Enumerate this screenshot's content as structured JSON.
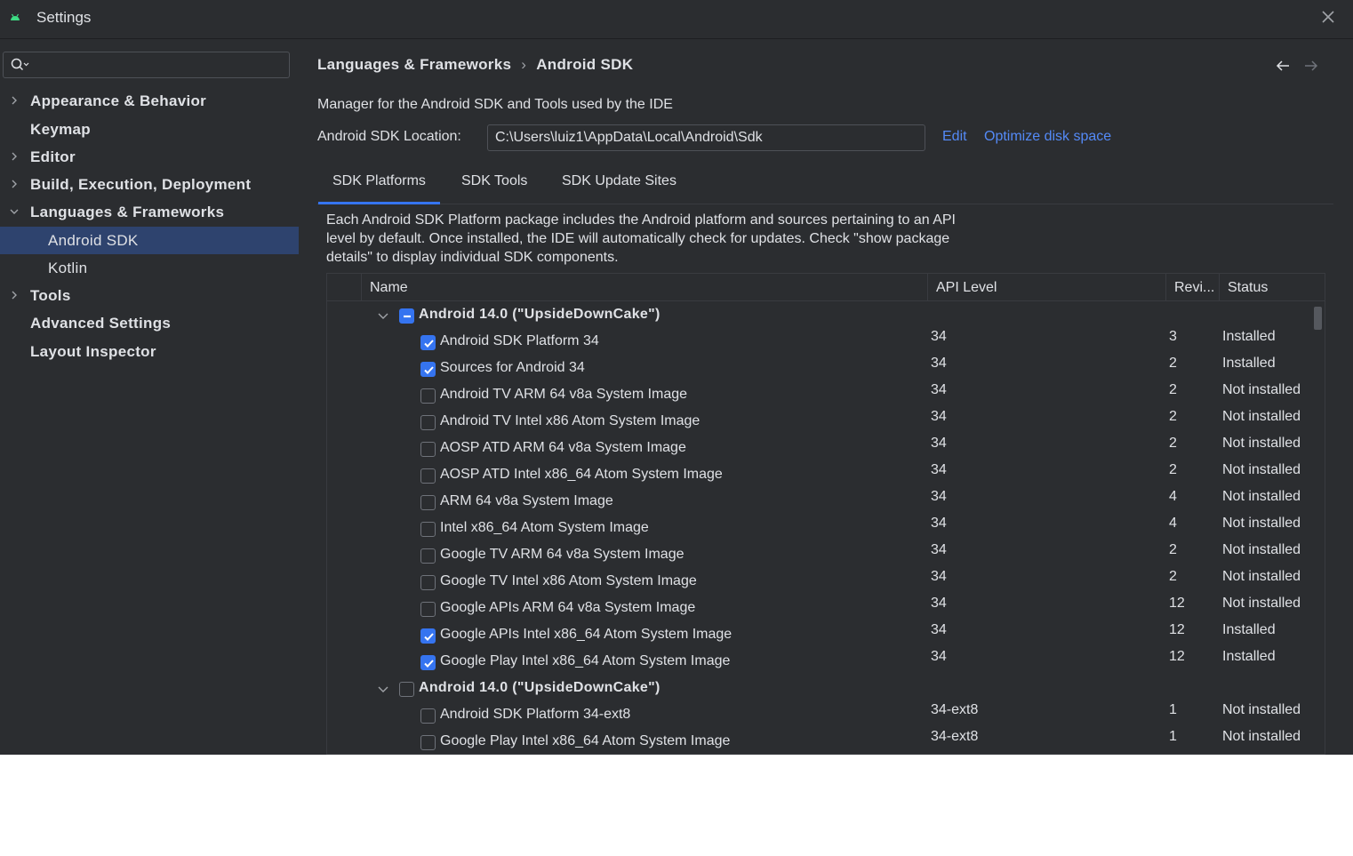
{
  "window": {
    "title": "Settings"
  },
  "sidebar": {
    "search_placeholder": "",
    "items": [
      {
        "label": "Appearance & Behavior",
        "expandable": true,
        "expanded": false,
        "child": false
      },
      {
        "label": "Keymap",
        "expandable": false,
        "child": false
      },
      {
        "label": "Editor",
        "expandable": true,
        "expanded": false,
        "child": false
      },
      {
        "label": "Build, Execution, Deployment",
        "expandable": true,
        "expanded": false,
        "child": false
      },
      {
        "label": "Languages & Frameworks",
        "expandable": true,
        "expanded": true,
        "child": false
      },
      {
        "label": "Android SDK",
        "expandable": false,
        "child": true,
        "selected": true
      },
      {
        "label": "Kotlin",
        "expandable": false,
        "child": true
      },
      {
        "label": "Tools",
        "expandable": true,
        "expanded": false,
        "child": false
      },
      {
        "label": "Advanced Settings",
        "expandable": false,
        "child": false
      },
      {
        "label": "Layout Inspector",
        "expandable": false,
        "child": false
      }
    ]
  },
  "breadcrumb": {
    "parent": "Languages & Frameworks",
    "separator": "›",
    "current": "Android SDK"
  },
  "main": {
    "description": "Manager for the Android SDK and Tools used by the IDE",
    "location_label": "Android SDK Location:",
    "location_value": "C:\\Users\\luiz1\\AppData\\Local\\Android\\Sdk",
    "edit_link": "Edit",
    "optimize_link": "Optimize disk space",
    "tabs": [
      {
        "label": "SDK Platforms",
        "active": true
      },
      {
        "label": "SDK Tools",
        "active": false
      },
      {
        "label": "SDK Update Sites",
        "active": false
      }
    ],
    "info_text": "Each Android SDK Platform package includes the Android platform and sources pertaining to an API level by default. Once installed, the IDE will automatically check for updates. Check \"show package details\" to display individual SDK components."
  },
  "table": {
    "columns": {
      "name": "Name",
      "api": "API Level",
      "revision": "Revi...",
      "status": "Status"
    },
    "rows": [
      {
        "type": "group",
        "name": "Android 14.0 (\"UpsideDownCake\")",
        "state": "partial",
        "api": "",
        "revision": "",
        "status": ""
      },
      {
        "type": "item",
        "name": "Android SDK Platform 34",
        "state": "checked",
        "api": "34",
        "revision": "3",
        "status": "Installed"
      },
      {
        "type": "item",
        "name": "Sources for Android 34",
        "state": "checked",
        "api": "34",
        "revision": "2",
        "status": "Installed"
      },
      {
        "type": "item",
        "name": "Android TV ARM 64 v8a System Image",
        "state": "unchecked",
        "api": "34",
        "revision": "2",
        "status": "Not installed"
      },
      {
        "type": "item",
        "name": "Android TV Intel x86 Atom System Image",
        "state": "unchecked",
        "api": "34",
        "revision": "2",
        "status": "Not installed"
      },
      {
        "type": "item",
        "name": "AOSP ATD ARM 64 v8a System Image",
        "state": "unchecked",
        "api": "34",
        "revision": "2",
        "status": "Not installed"
      },
      {
        "type": "item",
        "name": "AOSP ATD Intel x86_64 Atom System Image",
        "state": "unchecked",
        "api": "34",
        "revision": "2",
        "status": "Not installed"
      },
      {
        "type": "item",
        "name": "ARM 64 v8a System Image",
        "state": "unchecked",
        "api": "34",
        "revision": "4",
        "status": "Not installed"
      },
      {
        "type": "item",
        "name": "Intel x86_64 Atom System Image",
        "state": "unchecked",
        "api": "34",
        "revision": "4",
        "status": "Not installed"
      },
      {
        "type": "item",
        "name": "Google TV ARM 64 v8a System Image",
        "state": "unchecked",
        "api": "34",
        "revision": "2",
        "status": "Not installed"
      },
      {
        "type": "item",
        "name": "Google TV Intel x86 Atom System Image",
        "state": "unchecked",
        "api": "34",
        "revision": "2",
        "status": "Not installed"
      },
      {
        "type": "item",
        "name": "Google APIs ARM 64 v8a System Image",
        "state": "unchecked",
        "api": "34",
        "revision": "12",
        "status": "Not installed"
      },
      {
        "type": "item",
        "name": "Google APIs Intel x86_64 Atom System Image",
        "state": "checked",
        "api": "34",
        "revision": "12",
        "status": "Installed"
      },
      {
        "type": "item",
        "name": "Google Play Intel x86_64 Atom System Image",
        "state": "checked",
        "api": "34",
        "revision": "12",
        "status": "Installed"
      },
      {
        "type": "group",
        "name": "Android 14.0 (\"UpsideDownCake\")",
        "state": "unchecked",
        "api": "",
        "revision": "",
        "status": ""
      },
      {
        "type": "item",
        "name": "Android SDK Platform 34-ext8",
        "state": "unchecked",
        "api": "34-ext8",
        "revision": "1",
        "status": "Not installed"
      },
      {
        "type": "item",
        "name": "Google Play Intel x86_64 Atom System Image",
        "state": "unchecked",
        "api": "34-ext8",
        "revision": "1",
        "status": "Not installed"
      }
    ]
  },
  "colors": {
    "background": "#2b2d30",
    "selection": "#2e436e",
    "accent": "#3574f0",
    "link": "#548af7",
    "text": "#dfe1e5"
  },
  "icons": [
    "android-icon",
    "close-icon",
    "search-icon",
    "chevron-right-icon",
    "chevron-down-icon",
    "arrow-left-icon",
    "arrow-right-icon",
    "checkbox-icon"
  ]
}
